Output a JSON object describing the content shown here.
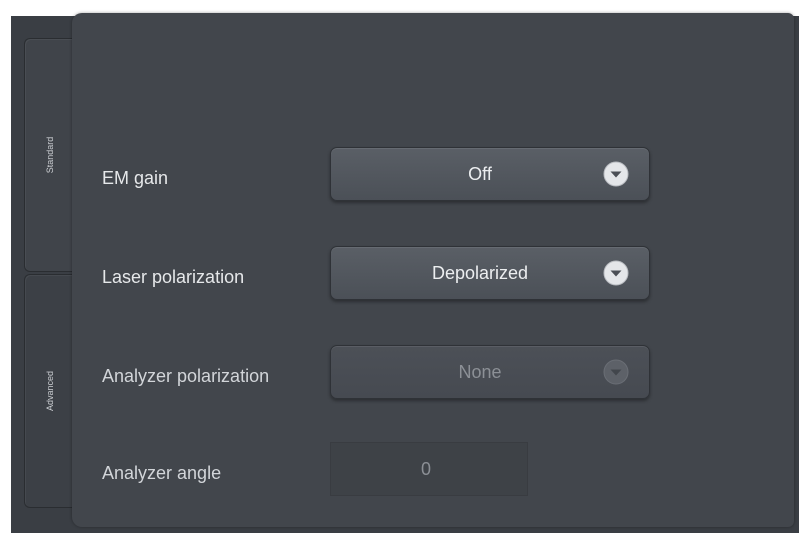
{
  "tabs": {
    "standard": "Standard",
    "advanced": "Advanced"
  },
  "rows": {
    "em_gain": {
      "label": "EM gain",
      "value": "Off"
    },
    "laser_polarization": {
      "label": "Laser polarization",
      "value": "Depolarized"
    },
    "analyzer_polarization": {
      "label": "Analyzer polarization",
      "value": "None"
    },
    "analyzer_angle": {
      "label": "Analyzer angle",
      "value": "0"
    }
  },
  "icons": {
    "dropdown": "chevron-down-icon"
  },
  "colors": {
    "panel": "#42464c",
    "text": "#e6e8ea",
    "disabled_text": "#8c9096"
  }
}
